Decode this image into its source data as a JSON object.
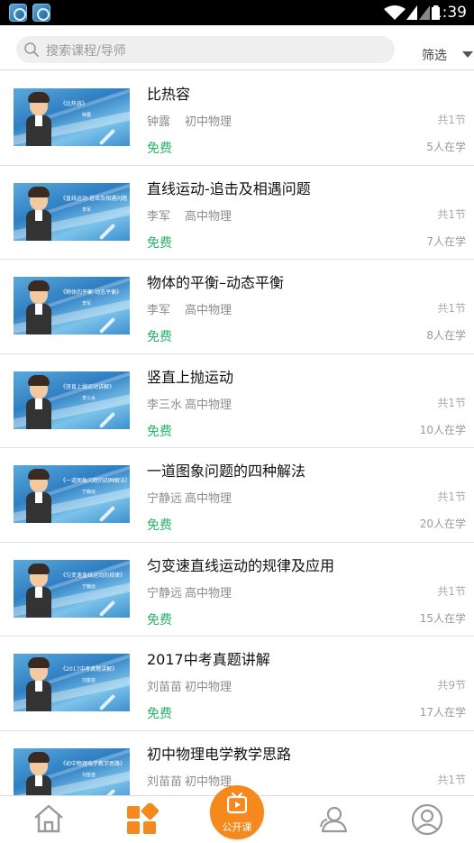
{
  "status_bar": {
    "time": "1:39",
    "left_icons": [
      "app-notification-icon",
      "app-notification-icon"
    ],
    "right_icons": [
      "wifi-icon",
      "signal-icon",
      "signal-icon",
      "battery-icon"
    ]
  },
  "search": {
    "placeholder": "搜索课程/导师",
    "filter_label": "筛选"
  },
  "courses": [
    {
      "title": "比热容",
      "teacher": "钟露",
      "subject": "初中物理",
      "sections": "共1节",
      "price": "免费",
      "learners": "5人在学",
      "thumb_title": "《比热容》",
      "thumb_teacher": "钟露"
    },
    {
      "title": "直线运动-追击及相遇问题",
      "teacher": "李军",
      "subject": "高中物理",
      "sections": "共1节",
      "price": "免费",
      "learners": "7人在学",
      "thumb_title": "《直线运动-追击及相遇问题》",
      "thumb_teacher": "李军"
    },
    {
      "title": "物体的平衡–动态平衡",
      "teacher": "李军",
      "subject": "高中物理",
      "sections": "共1节",
      "price": "免费",
      "learners": "8人在学",
      "thumb_title": "《物体的平衡-动态平衡》",
      "thumb_teacher": "李军"
    },
    {
      "title": "竖直上抛运动",
      "teacher": "李三水",
      "subject": "高中物理",
      "sections": "共1节",
      "price": "免费",
      "learners": "10人在学",
      "thumb_title": "《竖直上抛运动讲解》",
      "thumb_teacher": "李三水"
    },
    {
      "title": "一道图象问题的四种解法",
      "teacher": "宁静远",
      "subject": "高中物理",
      "sections": "共1节",
      "price": "免费",
      "learners": "20人在学",
      "thumb_title": "《一道图象问题的四种解法》",
      "thumb_teacher": "宁静远"
    },
    {
      "title": "匀变速直线运动的规律及应用",
      "teacher": "宁静远",
      "subject": "高中物理",
      "sections": "共1节",
      "price": "免费",
      "learners": "15人在学",
      "thumb_title": "《匀变速直线运动的规律》",
      "thumb_teacher": "宁静远"
    },
    {
      "title": "2017中考真题讲解",
      "teacher": "刘苗苗",
      "subject": "初中物理",
      "sections": "共9节",
      "price": "免费",
      "learners": "17人在学",
      "thumb_title": "《2017中考真题讲解》",
      "thumb_teacher": "刘苗苗"
    },
    {
      "title": "初中物理电学教学思路",
      "teacher": "刘苗苗",
      "subject": "初中物理",
      "sections": "共1节",
      "price": "",
      "learners": "",
      "thumb_title": "《初中物理电学教学思路》",
      "thumb_teacher": "刘苗苗"
    }
  ],
  "bottom_nav": {
    "items": [
      {
        "icon": "home-icon"
      },
      {
        "icon": "category-grid-icon",
        "active": true
      },
      {
        "icon": "tv-play-icon",
        "label": "公开课"
      },
      {
        "icon": "contacts-icon"
      },
      {
        "icon": "profile-icon"
      }
    ]
  },
  "colors": {
    "accent_orange": "#f5891e",
    "free_green": "#27b46a",
    "status_bar": "#000000"
  }
}
